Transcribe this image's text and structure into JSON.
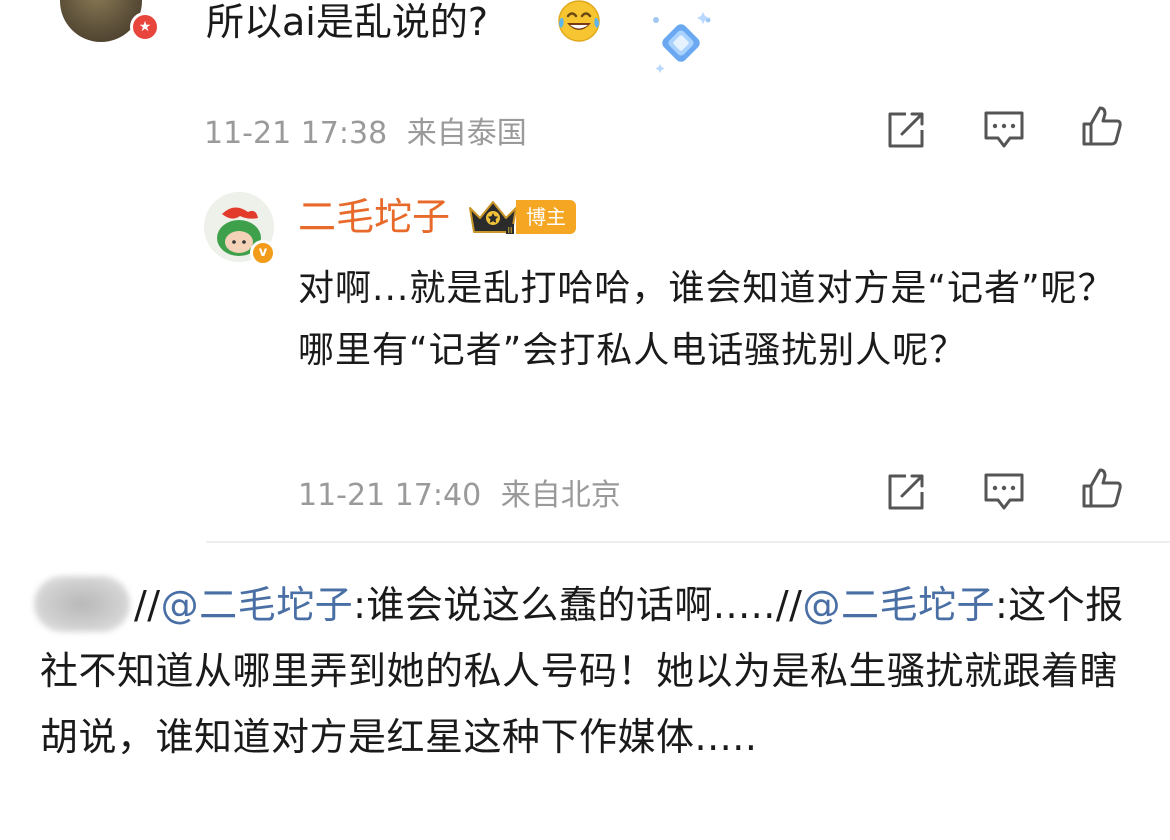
{
  "top_comment": {
    "text": "所以ai是乱说的?",
    "emoji": "laughing-tears-emoji",
    "sticker": "blue-diamond-sticker",
    "timestamp": "11-21 17:38",
    "location": "来自泰国",
    "badge_icon": "star-badge-icon"
  },
  "reply": {
    "username": "二毛坨子",
    "host_badge": "博主",
    "crown_icon": "crown-icon",
    "verified_badge": "v",
    "text": "对啊...就是乱打哈哈，谁会知道对方是“记者”呢？哪里有“记者”会打私人电话骚扰别人呢？",
    "timestamp": "11-21 17:40",
    "location": "来自北京"
  },
  "actions": {
    "share_icon": "share-icon",
    "comment_icon": "comment-icon",
    "like_icon": "thumbs-up-icon"
  },
  "bottom_comment": {
    "prefix1": "//",
    "mention1": "@二毛坨子",
    "text1": ":谁会说这么蠢的话啊.....",
    "prefix2": "//",
    "mention2": "@二毛坨子",
    "text2": ":这个报社不知道从哪里弄到她的私人号码！她以为是私生骚扰就跟着瞎胡说，谁知道对方是红星这种下作媒体....."
  },
  "colors": {
    "username": "#e86a2a",
    "mention": "#4a6fa5",
    "meta": "#9a9a9a",
    "host_badge": "#f5a623"
  }
}
